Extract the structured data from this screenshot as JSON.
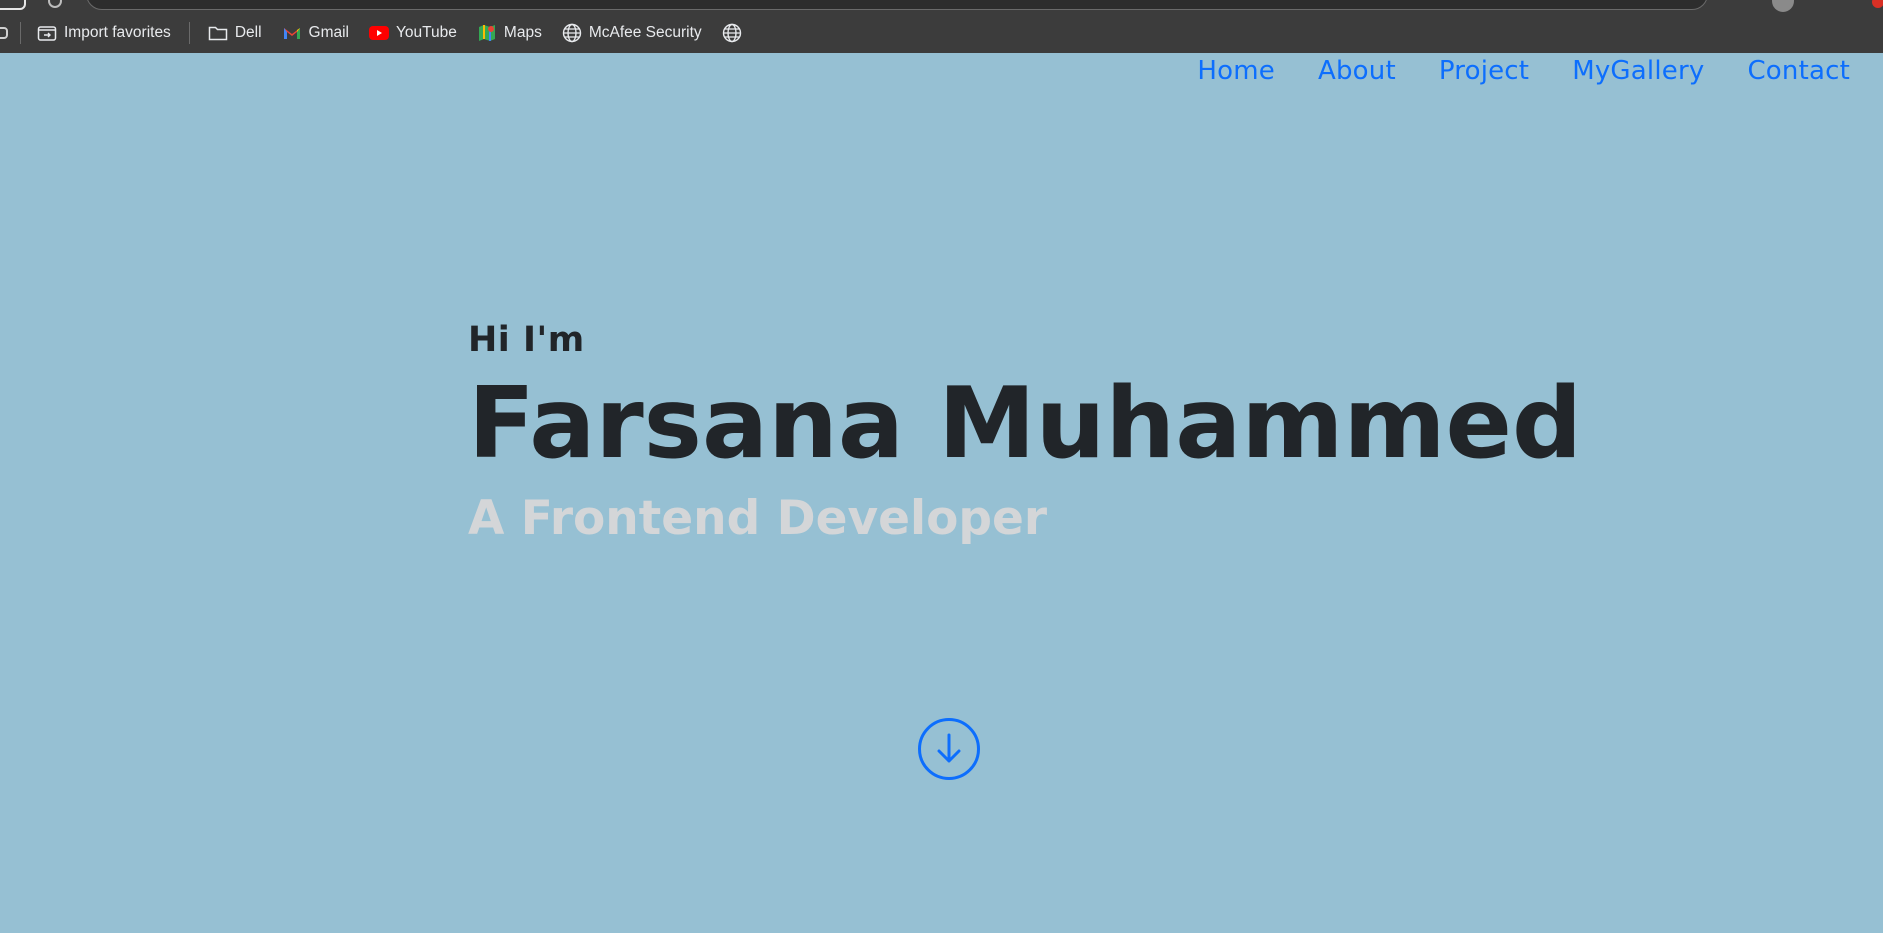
{
  "browser": {
    "bookmarks": [
      {
        "label": "Import favorites",
        "icon": "import-icon"
      },
      {
        "label": "Dell",
        "icon": "folder-icon"
      },
      {
        "label": "Gmail",
        "icon": "gmail-icon"
      },
      {
        "label": "YouTube",
        "icon": "youtube-icon"
      },
      {
        "label": "Maps",
        "icon": "maps-icon"
      },
      {
        "label": "McAfee Security",
        "icon": "globe-icon"
      }
    ]
  },
  "nav": {
    "items": [
      "Home",
      "About",
      "Project",
      "MyGallery",
      "Contact"
    ],
    "color": "#0d6efd"
  },
  "hero": {
    "greeting": "Hi I'm",
    "name": "Farsana Muhammed",
    "role": "A Frontend Developer",
    "scroll_icon": "arrow-down-circle-icon"
  },
  "colors": {
    "background": "#96c0d3",
    "text_dark": "#212529",
    "text_light": "#d4d6d8",
    "accent": "#0d6efd"
  }
}
